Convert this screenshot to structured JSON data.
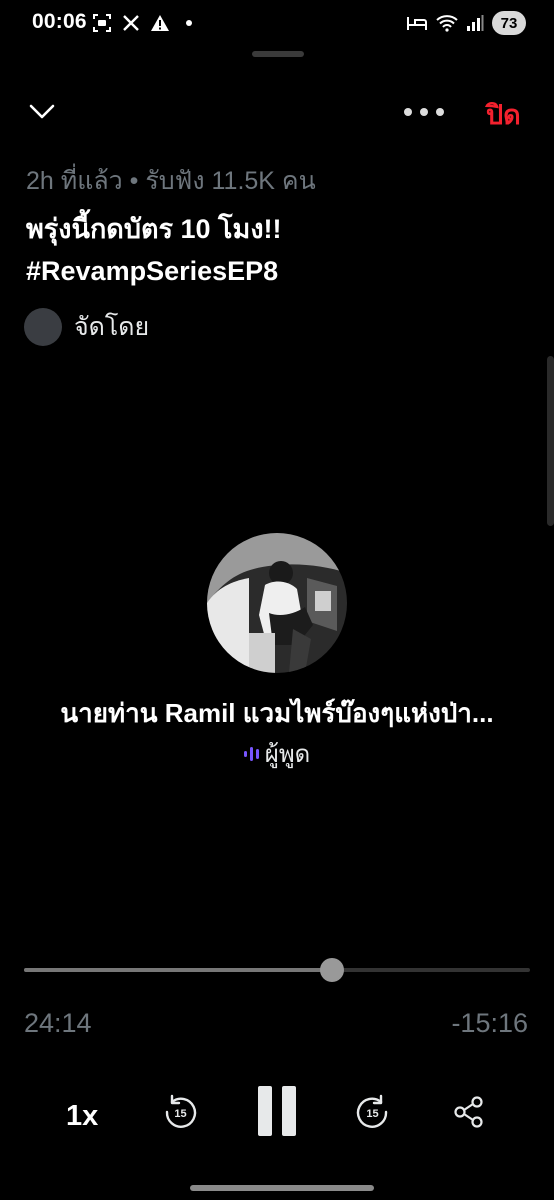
{
  "status_bar": {
    "time": "00:06",
    "battery": "73",
    "left_icons": [
      "screenshot-icon",
      "x-logo-icon",
      "warning-icon",
      "dot-icon"
    ],
    "right_icons": [
      "bed-icon",
      "wifi-icon",
      "signal-icon"
    ]
  },
  "header": {
    "close_label": "ปิด",
    "collapse_icon": "chevron-down-icon",
    "more_icon": "more-icon"
  },
  "space": {
    "meta": "2h ที่แล้ว • รับฟัง 11.5K คน",
    "title": "พรุ่งนี้กดบัตร 10 โมง!! #RevampSeriesEP8",
    "host_label": "จัดโดย"
  },
  "speaker": {
    "name": "นายท่าน Ramil แวมไพร์บ๊องๆแห่งป่า...",
    "role": "ผู้พูด"
  },
  "playback": {
    "elapsed": "24:14",
    "remaining": "-15:16",
    "progress": 0.608,
    "speed": "1x",
    "skip_back_seconds": "15",
    "skip_forward_seconds": "15"
  },
  "colors": {
    "background": "#000000",
    "close_red": "#f4212e",
    "muted_text": "#6e767d",
    "speaking_purple": "#7856ff"
  }
}
